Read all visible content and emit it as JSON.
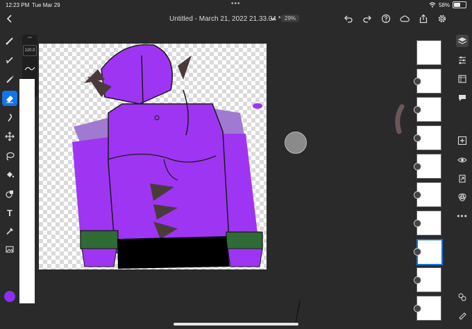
{
  "status": {
    "time": "12:23 PM",
    "date": "Tue Mar 29",
    "dots": "•••",
    "battery": "58%",
    "battery_level": 0.58
  },
  "topbar": {
    "title": "Untitled - March 21, 2022 21.33.04 *",
    "zoom": "29%"
  },
  "left_tools": [
    "pixel-brush-icon",
    "live-brush-icon",
    "vector-brush-icon",
    "eraser-icon",
    "smudge-icon",
    "move-icon",
    "lasso-icon",
    "fill-icon",
    "shape-icon",
    "text-icon",
    "eyedropper-icon",
    "image-icon"
  ],
  "active_tool": "eraser-icon",
  "text_tool_label": "T",
  "brush": {
    "size": "120.0"
  },
  "color": {
    "current": "#8b2ff0"
  },
  "right_tools": [
    "layers-icon",
    "adjustments-icon",
    "layer-properties-icon",
    "comments-icon",
    "add-layer-icon",
    "visibility-icon",
    "import-icon",
    "blend-icon",
    "more-icon",
    "mask-icon",
    "pencil-icon"
  ],
  "more_label": "•••",
  "layers": {
    "count": 10,
    "selected_index": 7
  }
}
